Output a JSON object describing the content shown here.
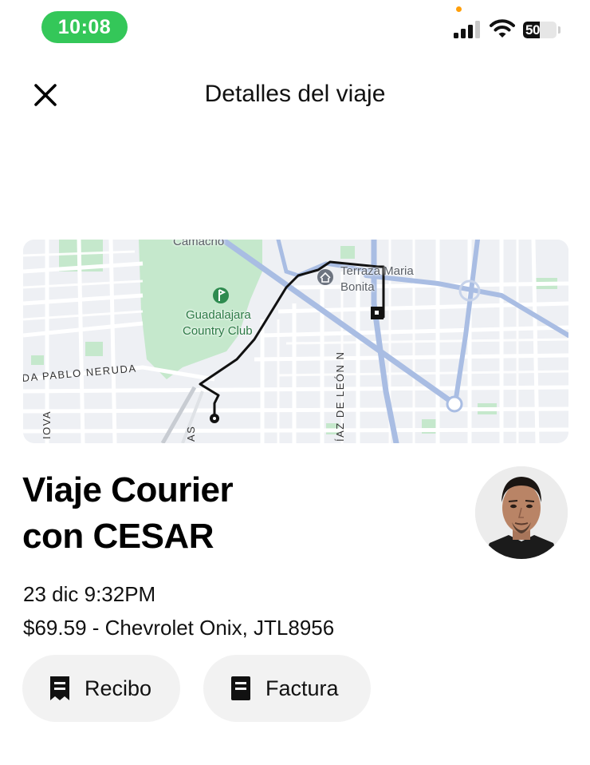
{
  "status_bar": {
    "time": "10:08",
    "battery_level": "50",
    "battery_percent": 50,
    "time_pill_color": "#34c759",
    "icons": [
      "signal-icon",
      "wifi-icon",
      "battery-icon"
    ]
  },
  "header": {
    "close_icon": "close-icon",
    "title": "Detalles del viaje"
  },
  "map": {
    "labels": {
      "camacho": "Camacho",
      "terraza": "Terraza Maria",
      "bonita": "Bonita",
      "club_line1": "Guadalajara",
      "club_line2": "Country Club",
      "neruda": "DA PABLO NERUDA",
      "diaz": "ÍAZ DE LEÓN N",
      "iova": "IOVA",
      "as": "AS"
    },
    "route_color": "#111111",
    "road_color": "#a9bde3"
  },
  "trip": {
    "title_line1": "Viaje Courier",
    "title_line2": "con CESAR",
    "date": "23 dic 9:32PM",
    "fare": "$69.59 - Chevrolet Onix, JTL8956"
  },
  "actions": {
    "receipt": {
      "label": "Recibo",
      "icon": "receipt-icon"
    },
    "invoice": {
      "label": "Factura",
      "icon": "invoice-icon"
    }
  }
}
